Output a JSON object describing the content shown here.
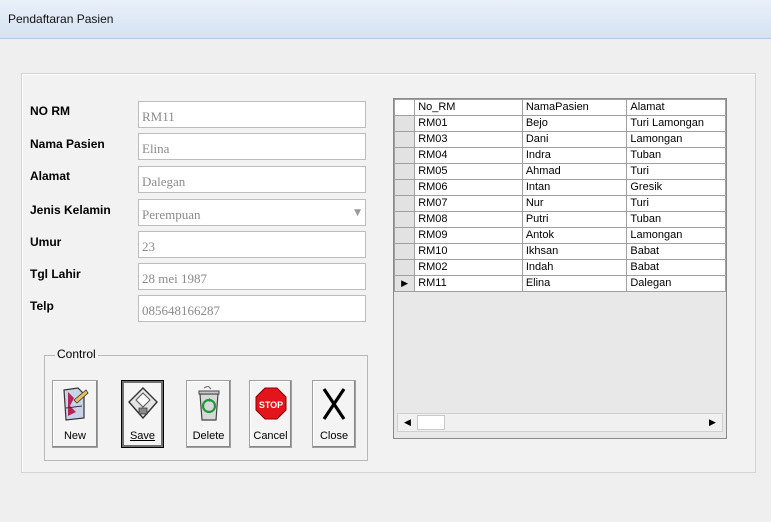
{
  "window": {
    "title": "Pendaftaran Pasien"
  },
  "form": {
    "fields": [
      {
        "label": "NO RM",
        "value": "RM11"
      },
      {
        "label": "Nama Pasien",
        "value": "Elina"
      },
      {
        "label": "Alamat",
        "value": "Dalegan"
      },
      {
        "label": "Jenis Kelamin",
        "value": "Perempuan",
        "type": "combo"
      },
      {
        "label": "Umur",
        "value": "23"
      },
      {
        "label": "Tgl Lahir",
        "value": "28 mei 1987"
      },
      {
        "label": "Telp",
        "value": "085648166287"
      }
    ]
  },
  "control": {
    "legend": "Control",
    "buttons": [
      {
        "label": "New",
        "icon": "new-document-icon"
      },
      {
        "label": "Save",
        "icon": "save-disk-icon",
        "selected": true
      },
      {
        "label": "Delete",
        "icon": "recycle-bin-icon"
      },
      {
        "label": "Cancel",
        "icon": "stop-sign-icon"
      },
      {
        "label": "Close",
        "icon": "x-close-icon"
      }
    ]
  },
  "grid": {
    "columns": [
      "No_RM",
      "NamaPasien",
      "Alamat"
    ],
    "rows": [
      [
        "RM01",
        "Bejo",
        "Turi Lamongan"
      ],
      [
        "RM03",
        "Dani",
        "Lamongan"
      ],
      [
        "RM04",
        "Indra",
        "Tuban"
      ],
      [
        "RM05",
        "Ahmad",
        "Turi"
      ],
      [
        "RM06",
        "Intan",
        "Gresik"
      ],
      [
        "RM07",
        "Nur",
        "Turi"
      ],
      [
        "RM08",
        "Putri",
        "Tuban"
      ],
      [
        "RM09",
        "Antok",
        "Lamongan"
      ],
      [
        "RM10",
        "Ikhsan",
        "Babat"
      ],
      [
        "RM02",
        "Indah",
        "Babat"
      ],
      [
        "RM11",
        "Elina",
        "Dalegan"
      ]
    ],
    "current_row_index": 10
  }
}
